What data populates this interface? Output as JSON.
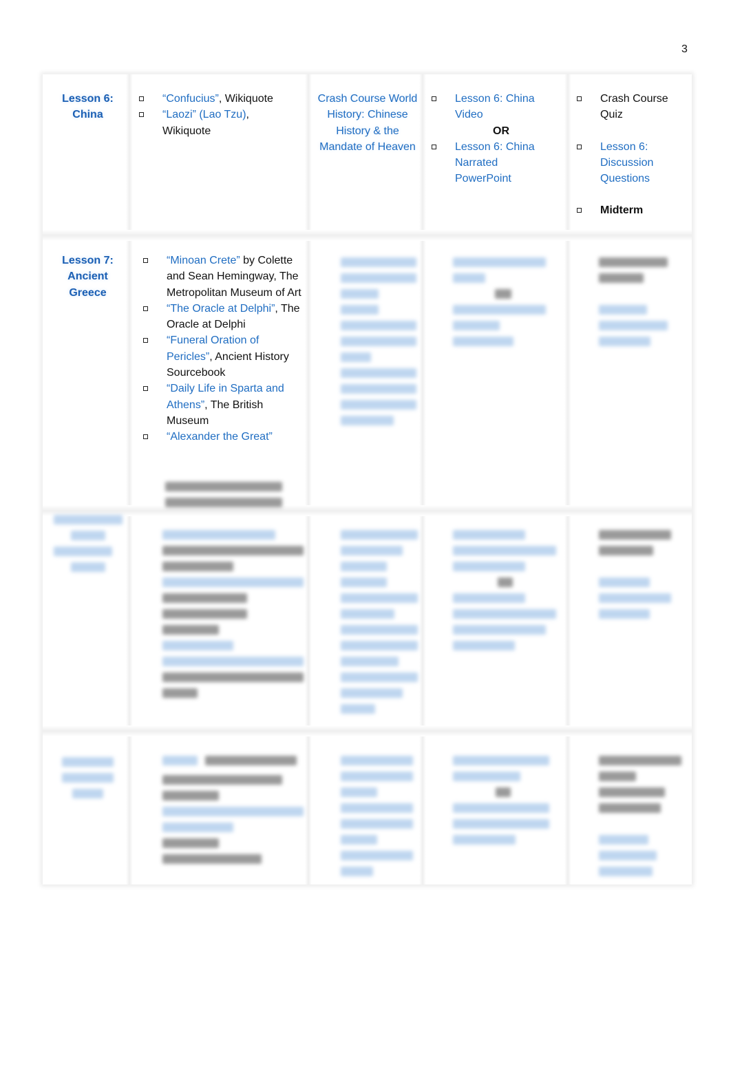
{
  "page_number": "3",
  "rows": [
    {
      "lesson": [
        "Lesson 6:",
        "China"
      ],
      "readings": [
        {
          "link": "“Confucius”",
          "rest": ", Wikiquote"
        },
        {
          "link": "“Laozi” (Lao Tzu)",
          "rest": ", Wikiquote"
        }
      ],
      "video": "Crash Course World History: Chinese History & the Mandate of Heaven",
      "lecture": {
        "option1": "Lesson 6: China Video",
        "or": "OR",
        "option2": "Lesson 6: China Narrated PowerPoint"
      },
      "assessments": [
        {
          "text": "Crash Course Quiz",
          "style": "plain"
        },
        {
          "text": "Lesson 6: Discussion Questions",
          "style": "link"
        },
        {
          "text": "Midterm",
          "style": "bold"
        }
      ]
    },
    {
      "lesson": [
        "Lesson 7:",
        "Ancient",
        "Greece"
      ],
      "readings": [
        {
          "link": "“Minoan Crete”",
          "rest": " by Colette and Sean Hemingway, The Metropolitan Museum of Art"
        },
        {
          "link": "“The Oracle at Delphi”",
          "rest": ", The Oracle at Delphi"
        },
        {
          "link": "“Funeral Oration of Pericles”",
          "rest": ", Ancient History Sourcebook"
        },
        {
          "link": "“Daily Life in Sparta and Athens”",
          "rest": ", The British Museum"
        },
        {
          "link": "“Alexander the Great”",
          "rest": ""
        }
      ]
    }
  ],
  "colors": {
    "link": "#1f6dc2",
    "heading": "#1a5fb4"
  }
}
